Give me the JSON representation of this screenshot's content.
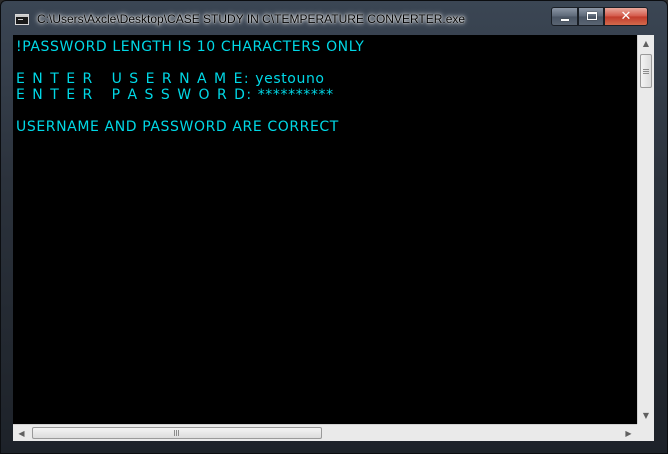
{
  "window": {
    "title": "C:\\Users\\Axcle\\Desktop\\CASE STUDY IN C\\TEMPERATURE CONVERTER.exe",
    "icon": "console-app-icon",
    "buttons": {
      "minimize": "minimize-icon",
      "maximize": "maximize-icon",
      "close_label": "✕"
    }
  },
  "console": {
    "text_color": "#00d8e6",
    "background_color": "#000000",
    "lines": {
      "notice": "!PASSWORD LENGTH IS 10 CHARACTERS ONLY",
      "username_prompt": "E N T E R   U S E R N A M E:",
      "username_value": "yestouno",
      "password_prompt": "E N T E R   P A S S W O R D:",
      "password_value": "**********",
      "result": "USERNAME AND PASSWORD ARE CORRECT"
    }
  },
  "scrollbars": {
    "up_arrow": "▲",
    "down_arrow": "▼",
    "left_arrow": "◀",
    "right_arrow": "▶"
  }
}
